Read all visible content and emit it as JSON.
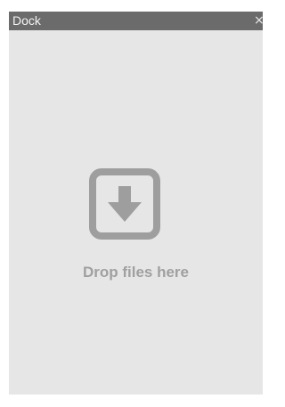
{
  "dock": {
    "title": "Dock",
    "close_glyph": "×",
    "drop_zone": {
      "icon": "download-arrow-icon",
      "label": "Drop files here"
    }
  },
  "colors": {
    "titlebar": "#6b6b6b",
    "panel_background": "#e6e6e6",
    "icon": "#9e9e9e",
    "label": "#a0a0a0"
  }
}
